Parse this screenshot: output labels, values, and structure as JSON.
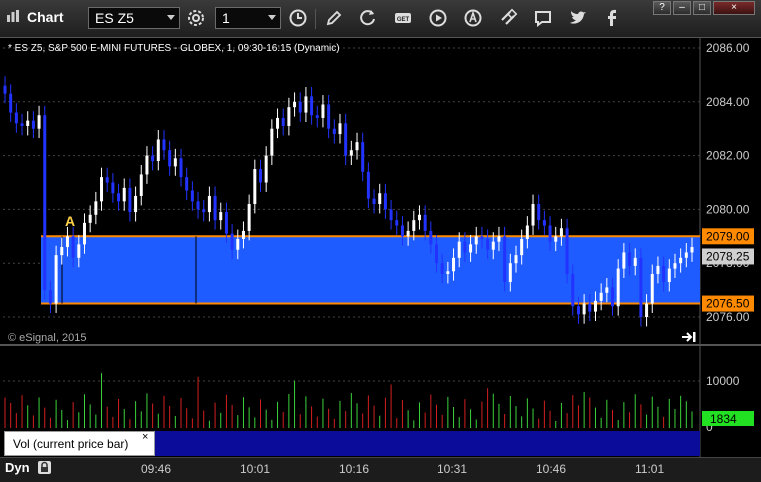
{
  "app": {
    "title": "Chart"
  },
  "toolbar": {
    "symbol_value": "ES Z5",
    "interval_value": "1",
    "icons": [
      "settings-icon",
      "clock-icon",
      "pencil-icon",
      "refresh-icon",
      "get-icon",
      "play-icon",
      "alert-icon",
      "link-icon",
      "comment-icon",
      "twitter-icon",
      "facebook-icon"
    ]
  },
  "window_buttons": {
    "help": "?",
    "minimize": "–",
    "maximize": "□",
    "close": "×"
  },
  "chart": {
    "subtitle": "* ES Z5, S&P 500 E-MINI FUTURES - GLOBEX, 1, 09:30-16:15 (Dynamic)",
    "copyright": "© eSignal, 2015",
    "marker": "A",
    "price_ticks": [
      "2086.00",
      "2084.00",
      "2082.00",
      "2080.00",
      "2078.00",
      "2076.00"
    ],
    "level_high": "2079.00",
    "level_current": "2078.25",
    "level_low": "2076.50",
    "level_color": "#ff8a00",
    "range_fill_color": "#1f5cff",
    "volume_ticks": [
      "10000",
      "0"
    ],
    "volume_current": "1834",
    "up_color": "#3cd33c",
    "down_color": "#d41f1f"
  },
  "chart_data": {
    "type": "candlestick",
    "title": "* ES Z5, S&P 500 E-MINI FUTURES - GLOBEX, 1, 09:30-16:15 (Dynamic)",
    "y_ticks": [
      2076,
      2078,
      2080,
      2082,
      2084,
      2086
    ],
    "ylim": [
      2075.0,
      2087.0
    ],
    "x_ticks": [
      "09:46",
      "10:01",
      "10:16",
      "10:31",
      "10:46",
      "11:01"
    ],
    "horizontal_levels": [
      2079.0,
      2076.5
    ],
    "current_price": 2078.25,
    "volume_ylim": [
      0,
      13000
    ],
    "volume_last": 1834,
    "closes": [
      2084.3,
      2083.6,
      2083.2,
      2083.1,
      2083.3,
      2083.0,
      2083.5,
      2077.0,
      2076.5,
      2078.3,
      2078.6,
      2079.0,
      2078.2,
      2078.7,
      2079.5,
      2079.8,
      2080.3,
      2081.2,
      2081.0,
      2080.6,
      2080.3,
      2080.8,
      2079.9,
      2080.5,
      2081.3,
      2082.0,
      2081.8,
      2082.6,
      2082.2,
      2081.6,
      2081.9,
      2081.2,
      2080.7,
      2080.3,
      2080.0,
      2079.9,
      2080.5,
      2079.6,
      2079.9,
      2079.1,
      2078.5,
      2078.9,
      2079.2,
      2080.2,
      2081.5,
      2081.0,
      2082.0,
      2083.0,
      2083.4,
      2083.1,
      2083.8,
      2084.0,
      2083.6,
      2084.2,
      2083.5,
      2083.4,
      2083.9,
      2083.0,
      2082.8,
      2083.2,
      2082.0,
      2082.2,
      2082.5,
      2081.4,
      2080.4,
      2080.2,
      2080.6,
      2080.0,
      2079.6,
      2079.4,
      2079.0,
      2079.2,
      2079.6,
      2079.8,
      2079.2,
      2078.7,
      2078.0,
      2077.6,
      2077.7,
      2078.2,
      2078.8,
      2078.4,
      2078.7,
      2079.0,
      2078.9,
      2078.5,
      2078.8,
      2079.0,
      2077.3,
      2078.0,
      2078.3,
      2078.9,
      2079.4,
      2080.2,
      2079.6,
      2079.4,
      2078.8,
      2079.0,
      2079.3,
      2077.6,
      2076.4,
      2076.1,
      2076.5,
      2076.2,
      2076.6,
      2076.9,
      2077.1,
      2076.4,
      2077.8,
      2078.4,
      2077.9,
      2078.2,
      2076.0,
      2076.5,
      2077.6,
      2077.9,
      2077.3,
      2077.8,
      2078.0,
      2078.2,
      2078.4,
      2078.6
    ]
  }
}
